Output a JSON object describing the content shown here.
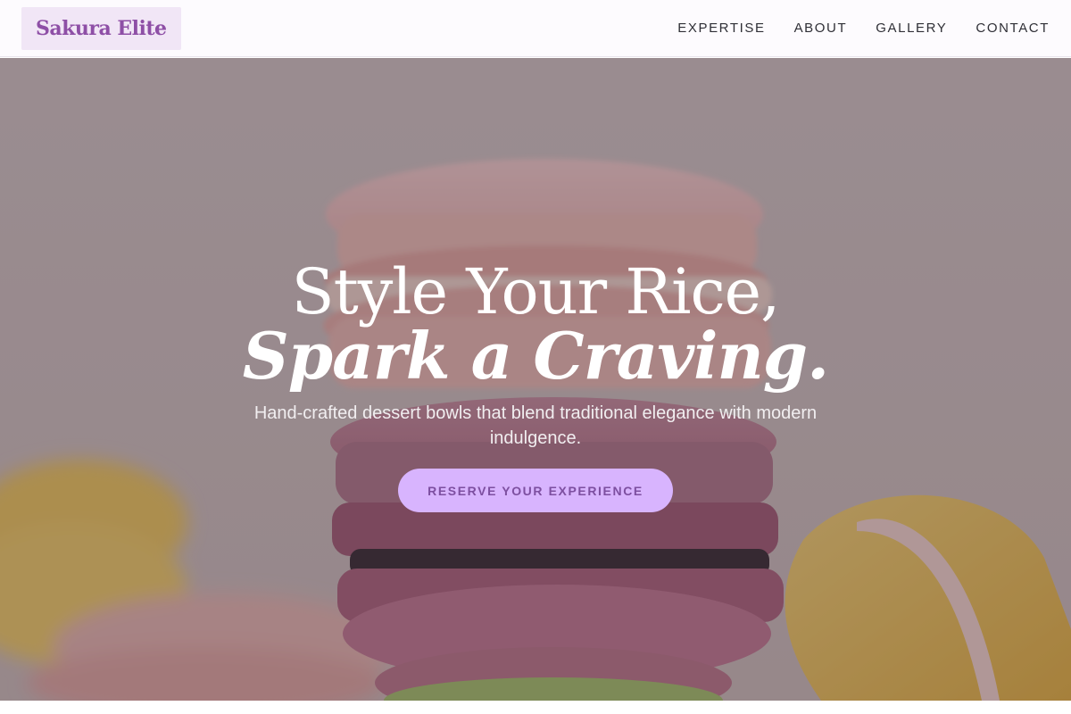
{
  "brand": {
    "name": "Sakura Elite"
  },
  "nav": {
    "items": [
      {
        "label": "EXPERTISE"
      },
      {
        "label": "ABOUT"
      },
      {
        "label": "GALLERY"
      },
      {
        "label": "CONTACT"
      }
    ]
  },
  "hero": {
    "title_line1": "Style Your Rice,",
    "title_line2": "Spark a Craving.",
    "subtitle": "Hand-crafted dessert bowls that blend traditional elegance with modern indulgence.",
    "cta_label": "RESERVE YOUR EXPERIENCE",
    "background_image": "macarons-photo"
  },
  "colors": {
    "brand": "#8e4fa6",
    "logo_bg": "#f1e6f6",
    "cta_bg": "#d8b4fe",
    "cta_text": "#7d4fa0"
  }
}
